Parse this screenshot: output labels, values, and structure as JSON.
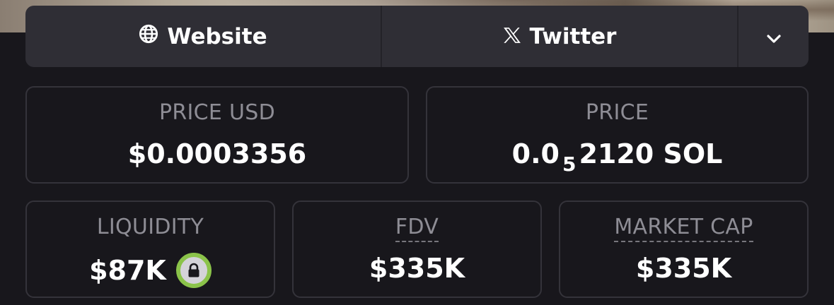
{
  "links": {
    "website_label": "Website",
    "twitter_label": "Twitter",
    "website_icon": "globe-icon",
    "twitter_icon": "x-logo-icon",
    "more_icon": "chevron-down-icon"
  },
  "price_usd": {
    "label": "PRICE USD",
    "value": "$0.0003356"
  },
  "price": {
    "label": "PRICE",
    "value_prefix": "0.0",
    "value_subscript": "5",
    "value_suffix": "2120 SOL"
  },
  "liquidity": {
    "label": "LIQUIDITY",
    "value": "$87K",
    "lock_icon": "lock-icon",
    "lock_color": "#8bc34a"
  },
  "fdv": {
    "label": "FDV",
    "value": "$335K"
  },
  "market_cap": {
    "label": "MARKET CAP",
    "value": "$335K"
  }
}
